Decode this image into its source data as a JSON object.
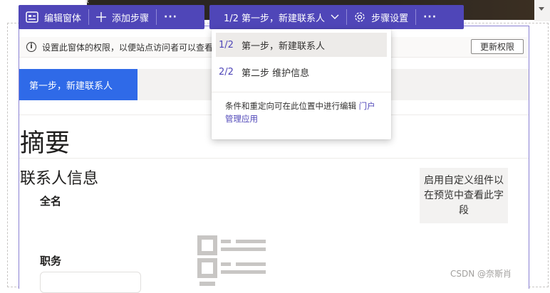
{
  "toolbar_left": {
    "edit_form_label": "编辑窗体",
    "add_step_label": "添加步骤",
    "more_label": "···"
  },
  "toolbar_right": {
    "step_selector_label": "1/2 第一步，新建联系人",
    "step_settings_label": "步骤设置",
    "more_label": "···"
  },
  "info_bar": {
    "message": "设置此窗体的权限，以便站点访问者可以查看",
    "update_button_label": "更新权限"
  },
  "step_tabs": [
    {
      "label": "第一步，新建联系人",
      "active": true
    }
  ],
  "step_dropdown": {
    "items": [
      {
        "number": "1/2",
        "label": "第一步，新建联系人",
        "selected": true
      },
      {
        "number": "2/2",
        "label": "第二步 维护信息",
        "selected": false
      }
    ],
    "note_text": "条件和重定向可在此位置中进行编辑 ",
    "note_link": "门户管理应用"
  },
  "form": {
    "summary_title": "摘要",
    "section_title": "联系人信息",
    "fields": [
      {
        "label": "全名"
      },
      {
        "label": "职务"
      }
    ],
    "custom_component_note": "启用自定义组件以在预览中查看此字段"
  },
  "watermark": "CSDN @奈斯肖",
  "colors": {
    "toolbar": "#4f46b8",
    "active_tab": "#2f6ae8",
    "canvas_border": "#8a81d3"
  }
}
